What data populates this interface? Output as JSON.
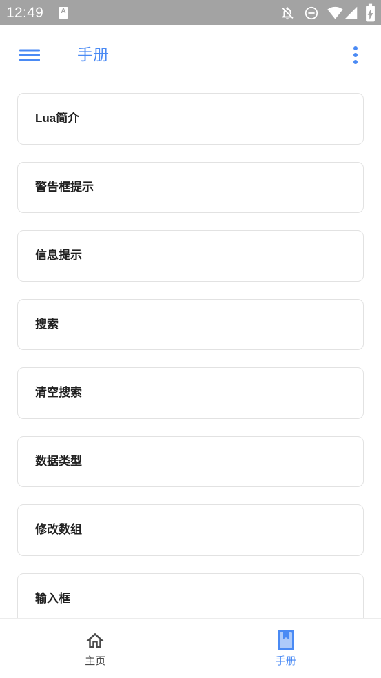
{
  "status_bar": {
    "time": "12:49",
    "notification_badge": "A",
    "icons": {
      "notification": "text-a-icon",
      "bell_off": "notifications-off-icon",
      "dnd": "do-not-disturb-icon",
      "wifi": "wifi-icon",
      "signal": "cellular-signal-icon",
      "battery": "battery-charging-icon"
    }
  },
  "app_bar": {
    "title": "手册",
    "menu_icon": "menu-icon",
    "more_icon": "more-vert-icon"
  },
  "manual_list": {
    "items": [
      {
        "label": "Lua简介"
      },
      {
        "label": "警告框提示"
      },
      {
        "label": "信息提示"
      },
      {
        "label": "搜索"
      },
      {
        "label": "清空搜索"
      },
      {
        "label": "数据类型"
      },
      {
        "label": "修改数组"
      },
      {
        "label": "输入框"
      }
    ]
  },
  "bottom_nav": {
    "items": [
      {
        "label": "主页",
        "icon": "home-icon",
        "selected": false
      },
      {
        "label": "手册",
        "icon": "book-icon",
        "selected": true
      }
    ]
  },
  "colors": {
    "accent": "#4a8af4",
    "status_bar": "#a3a3a3",
    "card_border": "#e2e2e2",
    "text": "#212121",
    "nav_inactive": "#4a4a4a"
  }
}
